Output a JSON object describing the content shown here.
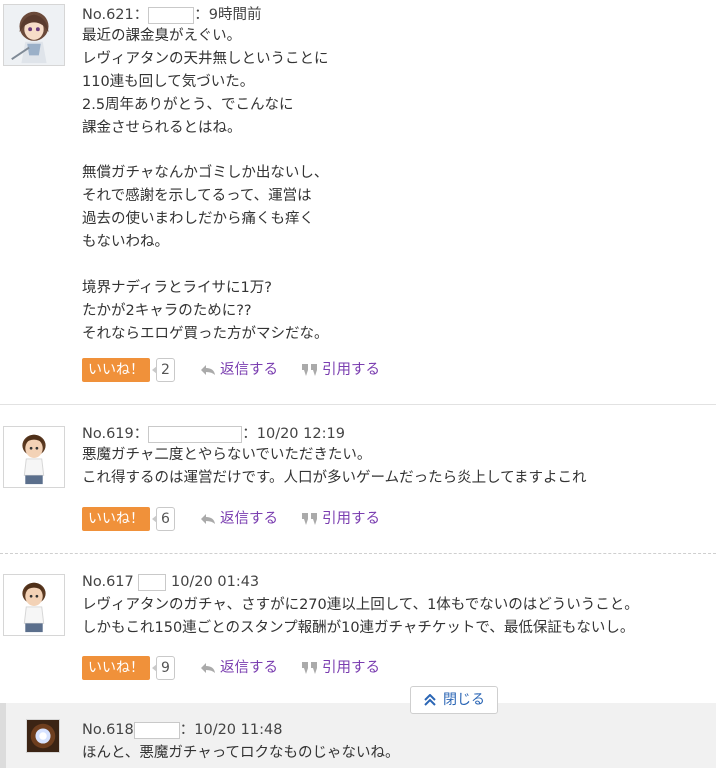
{
  "posts": [
    {
      "no": "No.621",
      "colon": "：",
      "time": "：9時間前",
      "lines": [
        "最近の課金臭がえぐい。",
        "レヴィアタンの天井無しということに",
        "110連も回して気づいた。",
        "2.5周年ありがとう、でこんなに",
        "課金させられるとはね。",
        "",
        "無償ガチャなんかゴミしか出ないし、",
        "それで感謝を示してるって、運営は",
        "過去の使いまわしだから痛くも痒く",
        "もないわね。",
        "",
        "境界ナディラとライサに1万?",
        "たかが2キャラのために??",
        "それならエロゲ買った方がマシだな。"
      ],
      "like_label": "いいね！",
      "like_count": "2",
      "reply_label": "返信する",
      "quote_label": "引用する"
    },
    {
      "no": "No.619",
      "colon": "：",
      "time": "：10/20 12:19",
      "lines": [
        "悪魔ガチャ二度とやらないでいただきたい。",
        "これ得するのは運営だけです。人口が多いゲームだったら炎上してますよこれ"
      ],
      "like_label": "いいね！",
      "like_count": "6",
      "reply_label": "返信する",
      "quote_label": "引用する"
    },
    {
      "no": "No.617",
      "colon": "",
      "time": "10/20 01:43",
      "lines": [
        "レヴィアタンのガチャ、さすがに270連以上回して、1体もでないのはどういうこと。",
        "しかもこれ150連ごとのスタンプ報酬が10連ガチャチケットで、最低保証もないし。"
      ],
      "like_label": "いいね！",
      "like_count": "9",
      "reply_label": "返信する",
      "quote_label": "引用する"
    }
  ],
  "collapse_label": "閉じる",
  "reply": {
    "no": "No.618",
    "time": "：10/20 11:48",
    "line": "ほんと、悪魔ガチャってロクなものじゃないね。"
  },
  "colors": {
    "like": "#f0913a",
    "action": "#7a3db0",
    "collapse": "#2b66b5"
  }
}
